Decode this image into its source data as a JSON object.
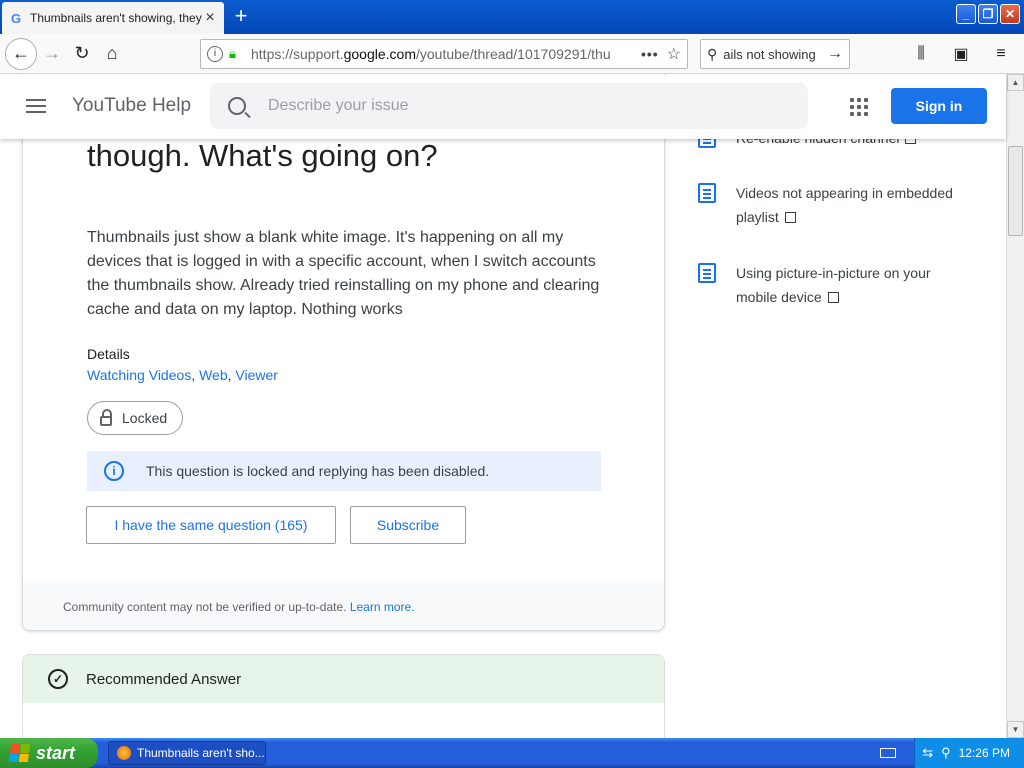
{
  "browser": {
    "tab_title": "Thumbnails aren't showing, they're",
    "tab_favicon": "G",
    "url_prefix": "https://support.",
    "url_domain": "google.com",
    "url_path": "/youtube/thread/101709291/thu",
    "search_text": "ails not showing",
    "new_tab": "+",
    "minimize": "_",
    "restore": "❐",
    "close": "✕"
  },
  "header": {
    "brand": "YouTube Help",
    "search_placeholder": "Describe your issue",
    "sign_in": "Sign in"
  },
  "question": {
    "title_tail": "though. What's going on?",
    "body": "Thumbnails just show a blank white image. It's happening on all my devices that is logged in with a specific account, when I switch accounts the thumbnails show. Already tried reinstalling on my phone and clearing cache and data on my laptop. Nothing works",
    "details_label": "Details",
    "details_links": [
      "Watching Videos",
      "Web",
      "Viewer"
    ],
    "locked_label": "Locked",
    "locked_notice": "This question is locked and replying has been disabled.",
    "same_question_button": "I have the same question (165)",
    "subscribe_button": "Subscribe",
    "footer_text": "Community content may not be verified or up-to-date.",
    "footer_link": "Learn more."
  },
  "recommended": {
    "heading": "Recommended Answer"
  },
  "sidebar": {
    "items": [
      {
        "label": "Re-enable hidden channel"
      },
      {
        "label": "Videos not appearing in embedded playlist"
      },
      {
        "label": "Using picture-in-picture on your mobile device"
      }
    ]
  },
  "taskbar": {
    "start": "start",
    "window_item": "Thumbnails aren't sho...",
    "clock": "12:26 PM"
  },
  "colors": {
    "accent": "#1a73e8",
    "notice_bg": "#e8f0fe",
    "recommended_bg": "#e6f4ea",
    "taskbar": "#245edb"
  }
}
